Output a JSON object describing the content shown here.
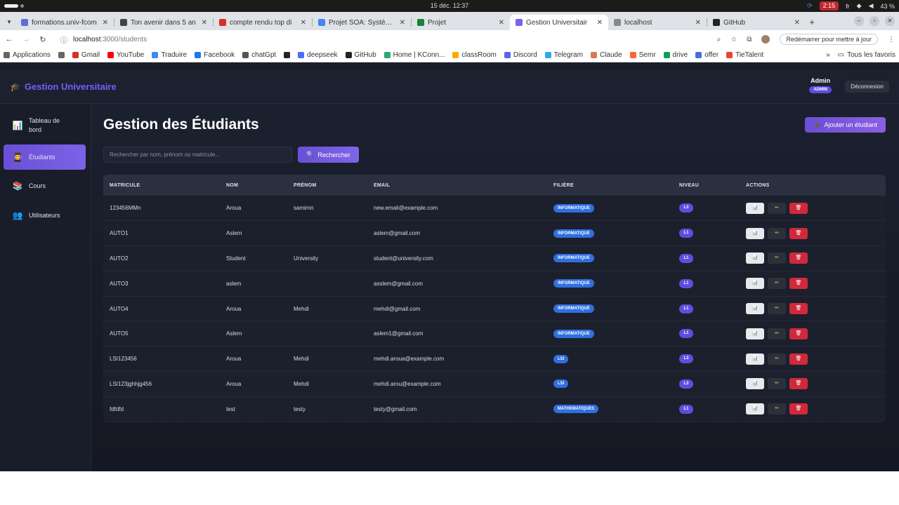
{
  "os": {
    "clock": "15 déc.  12:37",
    "recording": "2:15",
    "lang": "fr",
    "battery": "43 %"
  },
  "browser": {
    "tabs": [
      {
        "title": "formations.univ-fcom",
        "color": "#5a6fd6",
        "active": false
      },
      {
        "title": "Ton avenir dans 5 an",
        "color": "#444444",
        "active": false
      },
      {
        "title": "compte rendu top di",
        "color": "#d93025",
        "active": false
      },
      {
        "title": "Projet SOA: Systèmes",
        "color": "#4285f4",
        "active": false
      },
      {
        "title": "Projet",
        "color": "#188038",
        "active": false
      },
      {
        "title": "Gestion Universitair",
        "color": "#7b63e6",
        "active": true
      },
      {
        "title": "localhost",
        "color": "#888888",
        "active": false
      },
      {
        "title": "GitHub",
        "color": "#222222",
        "active": false
      }
    ],
    "url_host": "localhost",
    "url_path": ":3000/students",
    "relaunch_label": "Redémarrer pour mettre à jour",
    "bookmarks": [
      {
        "label": "Applications",
        "color": "#666666"
      },
      {
        "label": "",
        "color": "#666666"
      },
      {
        "label": "Gmail",
        "color": "#d93025"
      },
      {
        "label": "YouTube",
        "color": "#ff0000"
      },
      {
        "label": "Traduire",
        "color": "#4285f4"
      },
      {
        "label": "Facebook",
        "color": "#1877f2"
      },
      {
        "label": "chatGpt",
        "color": "#555555"
      },
      {
        "label": "",
        "color": "#222222"
      },
      {
        "label": "deepseek",
        "color": "#4d6bfe"
      },
      {
        "label": "GitHub",
        "color": "#222222"
      },
      {
        "label": "Home | KConn...",
        "color": "#2aa876"
      },
      {
        "label": "classRoom",
        "color": "#f9ab00"
      },
      {
        "label": "Discord",
        "color": "#5865f2"
      },
      {
        "label": "Telegram",
        "color": "#2aabee"
      },
      {
        "label": "Claude",
        "color": "#d97757"
      },
      {
        "label": "Semr",
        "color": "#ff642d"
      },
      {
        "label": "drive",
        "color": "#0f9d58"
      },
      {
        "label": "offer",
        "color": "#4a6ee0"
      },
      {
        "label": "TieTalent",
        "color": "#e8462a"
      }
    ],
    "all_bookmarks_label": "Tous les favoris"
  },
  "app": {
    "brand": "Gestion Universitaire",
    "user_name": "Admin",
    "user_role": "ADMIN",
    "logout_label": "Déconnexion",
    "sidebar": [
      {
        "icon": "📊",
        "label": "Tableau de bord",
        "active": false
      },
      {
        "icon": "👨‍🎓",
        "label": "Étudiants",
        "active": true
      },
      {
        "icon": "📚",
        "label": "Cours",
        "active": false
      },
      {
        "icon": "👥",
        "label": "Utilisateurs",
        "active": false
      }
    ],
    "page_title": "Gestion des Étudiants",
    "add_button": "Ajouter un étudiant",
    "search_placeholder": "Rechercher par nom, prénom ou matricule...",
    "search_button": "Rechercher",
    "columns": [
      "MATRICULE",
      "NOM",
      "PRÉNOM",
      "EMAIL",
      "FILIÈRE",
      "NIVEAU",
      "ACTIONS"
    ],
    "students": [
      {
        "matricule": "123456MMn",
        "nom": "Aroua",
        "prenom": "samirnn",
        "email": "new.email@example.com",
        "filiere": "INFORMATIQUE",
        "niveau": "L3"
      },
      {
        "matricule": "AUTO1",
        "nom": "Aslem",
        "prenom": "",
        "email": "aslem@gmail.com",
        "filiere": "INFORMATIQUE",
        "niveau": "L1"
      },
      {
        "matricule": "AUTO2",
        "nom": "Student",
        "prenom": "University",
        "email": "student@university.com",
        "filiere": "INFORMATIQUE",
        "niveau": "L1"
      },
      {
        "matricule": "AUTO3",
        "nom": "aslem",
        "prenom": "",
        "email": "asslem@gmail.com",
        "filiere": "INFORMATIQUE",
        "niveau": "L1"
      },
      {
        "matricule": "AUTO4",
        "nom": "Aroua",
        "prenom": "Mehdi",
        "email": "mehdi@gmail.com",
        "filiere": "INFORMATIQUE",
        "niveau": "L1"
      },
      {
        "matricule": "AUTO5",
        "nom": "Aslem",
        "prenom": "",
        "email": "aslem1@gmail.com",
        "filiere": "INFORMATIQUE",
        "niveau": "L1"
      },
      {
        "matricule": "LSI123456",
        "nom": "Aroua",
        "prenom": "Mehdi",
        "email": "mehdi.aroua@example.com",
        "filiere": "LSI",
        "niveau": "L3"
      },
      {
        "matricule": "LSI123jghhjg456",
        "nom": "Aroua",
        "prenom": "Mehdi",
        "email": "mehdi.arou@example.com",
        "filiere": "LSI",
        "niveau": "L3"
      },
      {
        "matricule": "fdfdfd",
        "nom": "test",
        "prenom": "testy",
        "email": "testy@gmail.com",
        "filiere": "MATHEMATIQUES",
        "niveau": "L1"
      }
    ],
    "action_icons": {
      "view": "📊",
      "edit": "✏",
      "delete": "🗑"
    },
    "colors": {
      "accent": "#6a4fd6",
      "filiere_badge": "#2f6fe0",
      "niveau_badge": "#5b4fe0",
      "delete": "#d0293c"
    }
  }
}
